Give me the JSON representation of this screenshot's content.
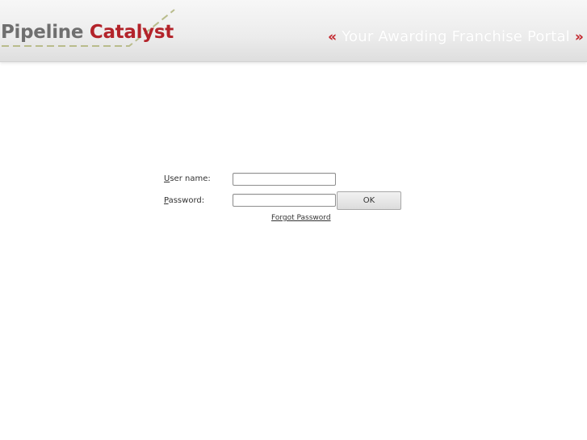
{
  "header": {
    "logo": {
      "word1": "Pipeline",
      "word2": "Catalyst"
    },
    "tagline": {
      "open_quote": "«",
      "text": "Your Awarding Franchise Portal",
      "close_quote": "»"
    }
  },
  "login": {
    "username": {
      "label_accel": "U",
      "label_rest": "ser name:",
      "value": ""
    },
    "password": {
      "label_accel": "P",
      "label_rest": "assword:",
      "value": ""
    },
    "ok_label": "OK",
    "forgot_label": "Forgot Password"
  },
  "colors": {
    "brand_red": "#b3232a",
    "brand_gray": "#6f6f6f",
    "swoosh": "#b9bc8c"
  }
}
